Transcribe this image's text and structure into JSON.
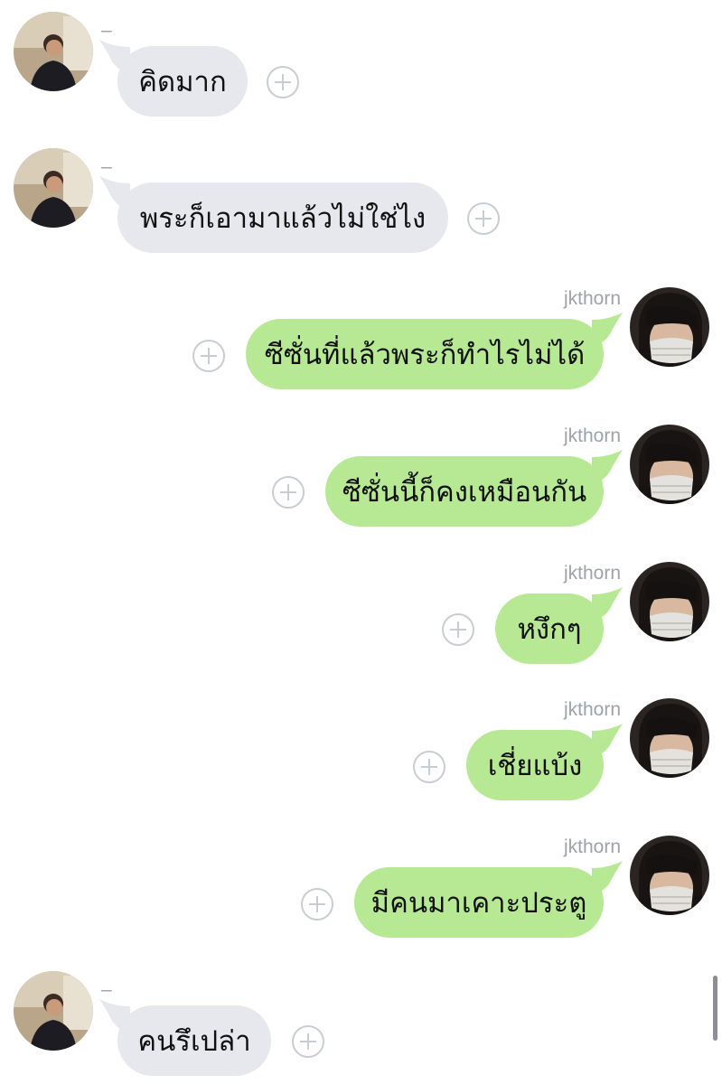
{
  "contacts": {
    "other": {
      "name": "–",
      "avatar_icon": "person-photo-avatar"
    },
    "me": {
      "name": "jkthorn",
      "avatar_icon": "masked-person-avatar"
    }
  },
  "messages": [
    {
      "from": "other",
      "text": "คิดมาก"
    },
    {
      "from": "other",
      "text": "พระก็เอามาแล้วไม่ใช่ไง"
    },
    {
      "from": "me",
      "text": "ซีซั่นที่แล้วพระก็ทำไรไม่ได้"
    },
    {
      "from": "me",
      "text": "ซีซั่นนี้ก็คงเหมือนกัน"
    },
    {
      "from": "me",
      "text": "หงึกๆ"
    },
    {
      "from": "me",
      "text": "เชี่ยแบ้ง"
    },
    {
      "from": "me",
      "text": "มีคนมาเคาะประตู"
    },
    {
      "from": "other",
      "text": "คนรึเปล่า"
    }
  ],
  "colors": {
    "incoming_bubble": "#e6e8ed",
    "outgoing_bubble": "#b7e994",
    "sender_name": "#9ca3ab",
    "add_button": "#c9ccd1"
  }
}
